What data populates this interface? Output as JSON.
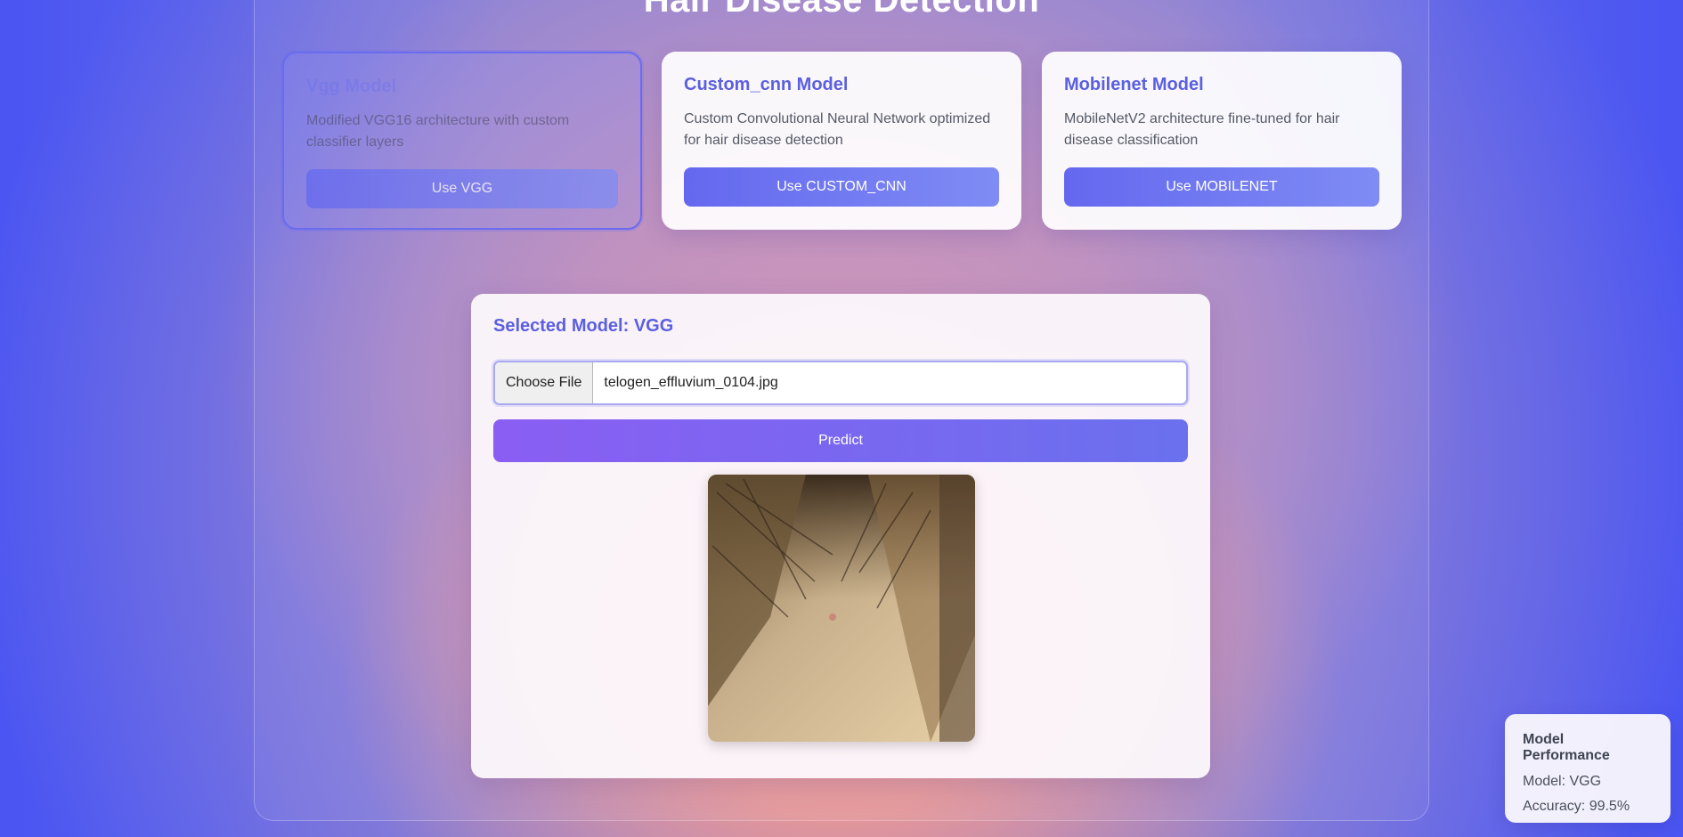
{
  "header": {
    "title": "Hair Disease Detection"
  },
  "models": [
    {
      "title": "Vgg Model",
      "description": "Modified VGG16 architecture with custom classifier layers",
      "button_label": "Use VGG"
    },
    {
      "title": "Custom_cnn Model",
      "description": "Custom Convolutional Neural Network optimized for hair disease detection",
      "button_label": "Use CUSTOM_CNN"
    },
    {
      "title": "Mobilenet Model",
      "description": "MobileNetV2 architecture fine-tuned for hair disease classification",
      "button_label": "Use MOBILENET"
    }
  ],
  "predict_panel": {
    "heading": "Selected Model: VGG",
    "choose_file_label": "Choose File",
    "file_name": "telogen_effluvium_0104.jpg",
    "predict_label": "Predict"
  },
  "performance": {
    "title": "Model Performance",
    "model_line": "Model: VGG",
    "accuracy_line": "Accuracy: 99.5%"
  },
  "colors": {
    "accent": "#5b5fe0",
    "button_gradient_start": "#6468ef",
    "predict_gradient_start": "#8a5ef3",
    "background": "#4a55f2"
  }
}
